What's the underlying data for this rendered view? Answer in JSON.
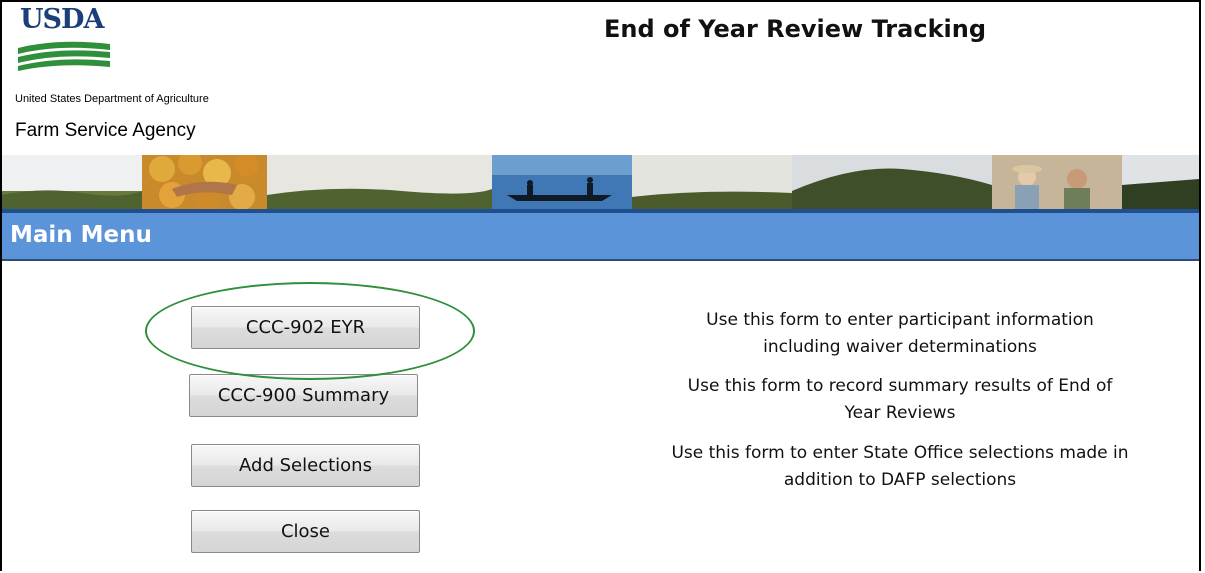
{
  "header": {
    "logo_text": "USDA",
    "department": "United States Department of Agriculture",
    "agency": "Farm Service Agency",
    "app_title": "End of Year Review Tracking"
  },
  "menu_bar": {
    "title": "Main Menu",
    "color": "#5b94d9"
  },
  "buttons": [
    {
      "label": "CCC-902 EYR",
      "highlighted": true
    },
    {
      "label": "CCC-900 Summary",
      "highlighted": false
    },
    {
      "label": "Add Selections",
      "highlighted": false
    },
    {
      "label": "Close",
      "highlighted": false
    }
  ],
  "descriptions": [
    {
      "lines": [
        "Use this form to enter participant information",
        "including waiver determinations"
      ]
    },
    {
      "lines": [
        "Use this form to record summary results of End of",
        "Year Reviews"
      ]
    },
    {
      "lines": [
        "Use this form to enter State Office selections made in",
        "addition to DAFP selections"
      ]
    }
  ],
  "colors": {
    "usda_blue": "#1a3f7a",
    "usda_green": "#2f8f3a",
    "highlight_ellipse": "#2f8f3a"
  }
}
